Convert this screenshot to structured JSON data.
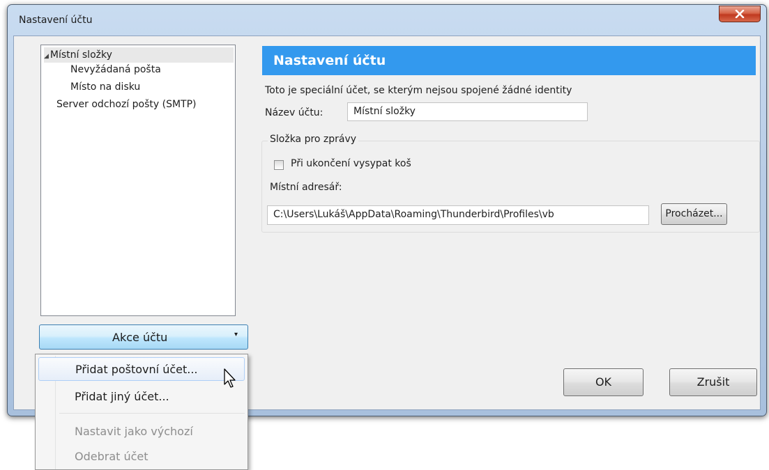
{
  "window": {
    "title": "Nastavení účtu"
  },
  "tree": {
    "items": [
      {
        "label": "Místní složky"
      },
      {
        "label": "Nevyžádaná pošta"
      },
      {
        "label": "Místo na disku"
      },
      {
        "label": "Server odchozí pošty (SMTP)"
      }
    ]
  },
  "account_actions": {
    "label": "Akce účtu"
  },
  "panel": {
    "header": "Nastavení účtu",
    "info": "Toto je speciální účet, se kterým nejsou spojené žádné identity",
    "name_label": "Název účtu:",
    "name_value": "Místní složky",
    "group_title": "Složka pro zprávy",
    "empty_trash_label": "Při ukončení vysypat koš",
    "empty_trash_checked": false,
    "local_dir_label": "Místní adresář:",
    "local_dir_value": "C:\\Users\\Lukáš\\AppData\\Roaming\\Thunderbird\\Profiles\\vb",
    "browse_label": "Procházet..."
  },
  "buttons": {
    "ok": "OK",
    "cancel": "Zrušit"
  },
  "menu": {
    "items": [
      {
        "label": "Přidat poštovní účet...",
        "enabled": true
      },
      {
        "label": "Přidat jiný účet...",
        "enabled": true
      },
      {
        "label": "Nastavit jako výchozí",
        "enabled": false
      },
      {
        "label": "Odebrat účet",
        "enabled": false
      }
    ]
  },
  "colors": {
    "header_bg": "#3399ee",
    "close_button": "#c7432b"
  }
}
